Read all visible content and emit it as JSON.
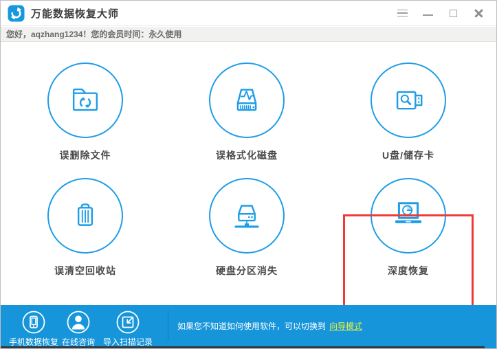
{
  "window": {
    "title": "万能数据恢复大师",
    "controls": {
      "menu": "menu",
      "minimize": "minimize",
      "maximize": "maximize",
      "close": "close"
    }
  },
  "welcome_bar": {
    "text": "您好，aqzhang1234！您的会员时间：永久使用"
  },
  "recovery_modes": [
    {
      "id": "deleted-files",
      "label": "误删除文件",
      "icon": "folder-recycle-icon",
      "highlighted": false
    },
    {
      "id": "formatted-disk",
      "label": "误格式化磁盘",
      "icon": "formatted-drive-icon",
      "highlighted": false
    },
    {
      "id": "usb-storage",
      "label": "U盘/储存卡",
      "icon": "usb-search-icon",
      "highlighted": false
    },
    {
      "id": "emptied-recycle",
      "label": "误清空回收站",
      "icon": "trash-can-icon",
      "highlighted": false
    },
    {
      "id": "lost-partition",
      "label": "硬盘分区消失",
      "icon": "hard-disk-network-icon",
      "highlighted": false
    },
    {
      "id": "deep-recovery",
      "label": "深度恢复",
      "icon": "laptop-clock-icon",
      "highlighted": true
    }
  ],
  "footer": {
    "actions": [
      {
        "id": "phone-recovery",
        "label": "手机数据恢复",
        "icon": "phone-icon"
      },
      {
        "id": "online-support",
        "label": "在线咨询",
        "icon": "person-icon"
      },
      {
        "id": "import-scan",
        "label": "导入扫描记录",
        "icon": "import-icon"
      }
    ],
    "hint_text": "如果您不知道如何使用软件，可以切换到",
    "hint_link": "向导模式"
  },
  "colors": {
    "accent_blue": "#1E9DE6",
    "footer_blue": "#1695DA",
    "logo_blue": "#1598DD",
    "highlight_red": "#EE3B36",
    "link_yellow": "#EFF23C",
    "welcome_bg": "#F1F1EF"
  }
}
